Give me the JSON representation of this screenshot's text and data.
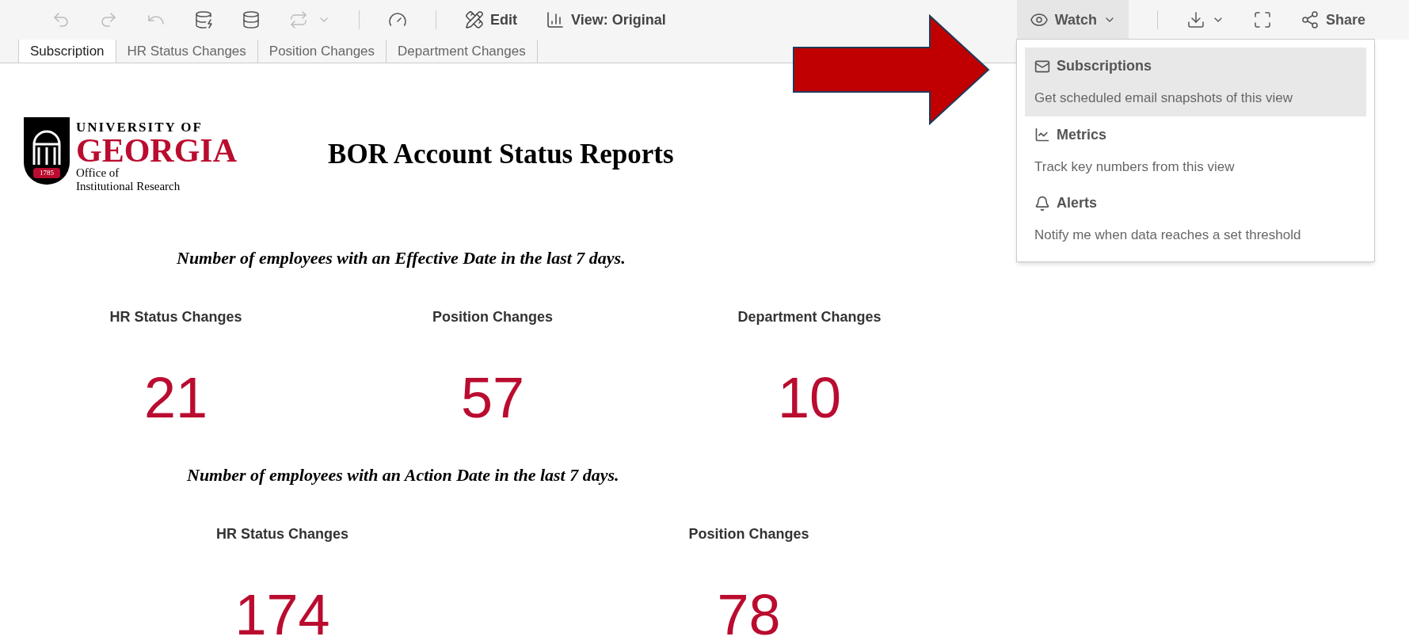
{
  "toolbar": {
    "edit": "Edit",
    "view": "View: Original",
    "watch": {
      "label": "Watch",
      "selected": true
    },
    "share": "Share"
  },
  "tabs": [
    {
      "label": "Subscription",
      "selected": true
    },
    {
      "label": "HR Status Changes",
      "selected": false
    },
    {
      "label": "Position Changes",
      "selected": false
    },
    {
      "label": "Department Changes",
      "selected": false
    }
  ],
  "logo": {
    "line_1": "UNIVERSITY OF",
    "line_2": "GEORGIA",
    "line_3": "Office of",
    "line_4": "Institutional Research",
    "year": "1785"
  },
  "title": "BOR Account Status Reports",
  "sections": [
    {
      "heading": "Number of employees with an Effective Date in the last 7 days.",
      "metrics": [
        {
          "label": "HR Status Changes",
          "value": "21"
        },
        {
          "label": "Position Changes",
          "value": "57"
        },
        {
          "label": "Department Changes",
          "value": "10"
        }
      ]
    },
    {
      "heading": "Number of employees with an Action Date in the last 7 days.",
      "metrics": [
        {
          "label": "HR Status Changes",
          "value": "174"
        },
        {
          "label": "Position Changes",
          "value": "78"
        }
      ]
    }
  ],
  "watch_menu": [
    {
      "kind": "mail",
      "title": "Subscriptions",
      "description": "Get scheduled email snapshots of this view",
      "selected": true
    },
    {
      "kind": "metric",
      "title": "Metrics",
      "description": "Track key numbers from this view",
      "selected": false
    },
    {
      "kind": "bell",
      "title": "Alerts",
      "description": "Notify me when data reaches a set threshold",
      "selected": false
    }
  ]
}
